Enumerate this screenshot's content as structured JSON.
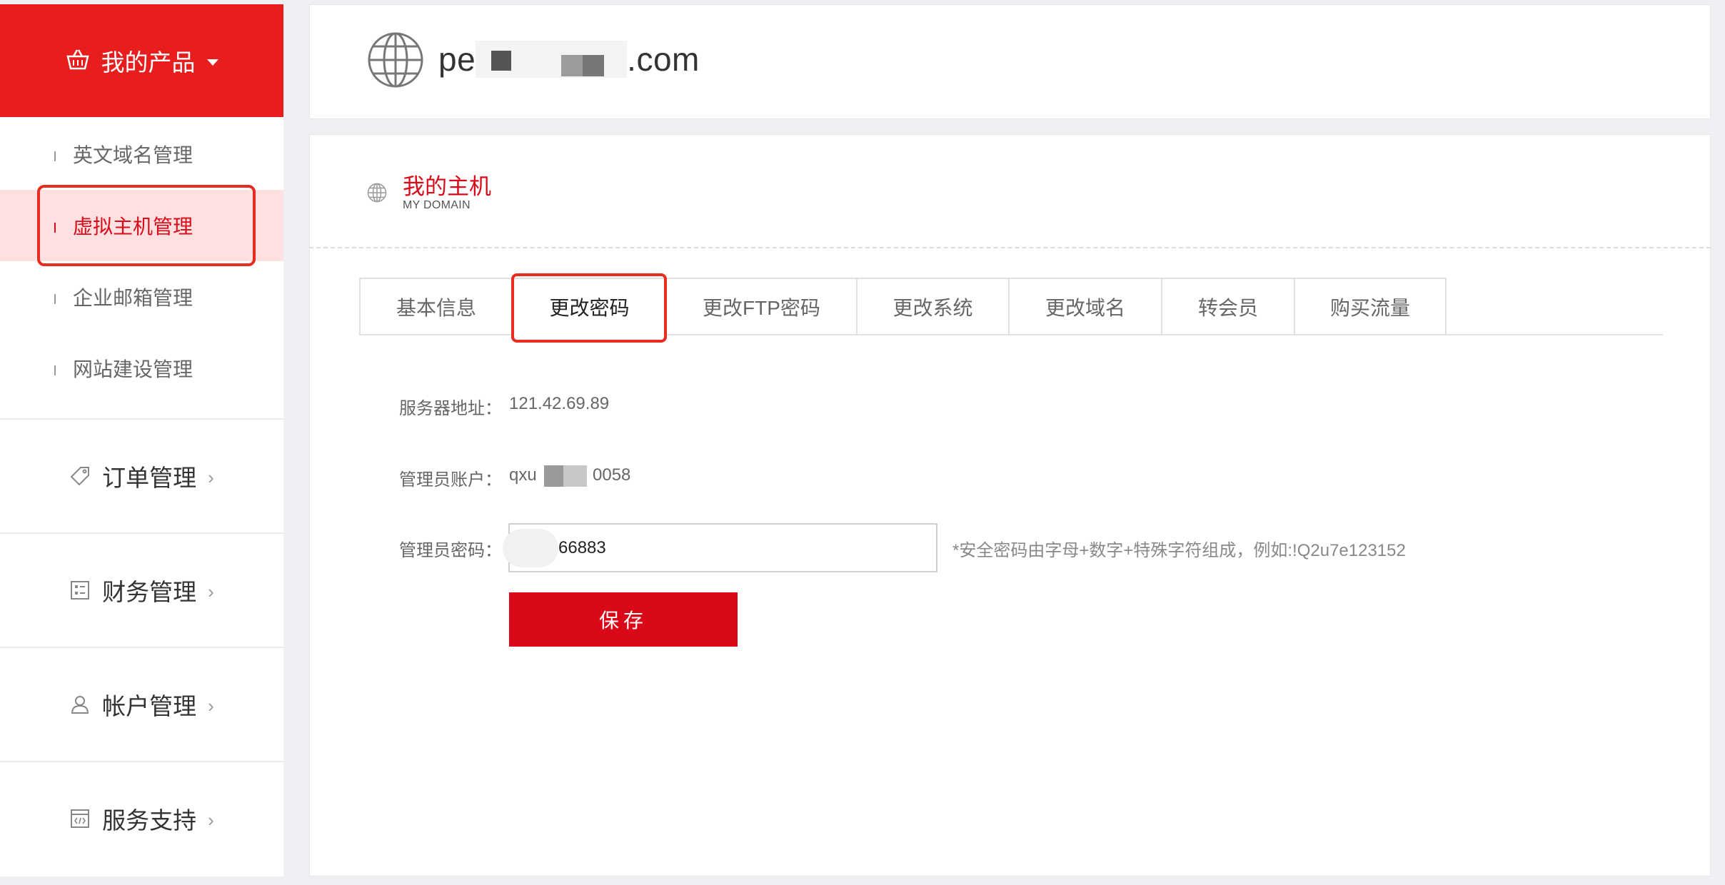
{
  "sidebar": {
    "header_label": "我的产品",
    "sub_items": [
      {
        "label": "英文域名管理"
      },
      {
        "label": "虚拟主机管理"
      },
      {
        "label": "企业邮箱管理"
      },
      {
        "label": "网站建设管理"
      }
    ],
    "groups": [
      {
        "label": "订单管理",
        "icon": "tag-icon"
      },
      {
        "label": "财务管理",
        "icon": "finance-icon"
      },
      {
        "label": "帐户管理",
        "icon": "user-icon"
      },
      {
        "label": "服务支持",
        "icon": "code-window-icon"
      }
    ],
    "chevron": "›"
  },
  "header": {
    "domain_prefix": "pe",
    "domain_suffix": ".com"
  },
  "section": {
    "title": "我的主机",
    "subtitle": "MY DOMAIN"
  },
  "tabs": [
    {
      "label": "基本信息"
    },
    {
      "label": "更改密码"
    },
    {
      "label": "更改FTP密码"
    },
    {
      "label": "更改系统"
    },
    {
      "label": "更改域名"
    },
    {
      "label": "转会员"
    },
    {
      "label": "购买流量"
    }
  ],
  "form": {
    "server_label": "服务器地址：",
    "server_value": "121.42.69.89",
    "account_label": "管理员账户：",
    "account_prefix": "qxu",
    "account_suffix": "0058",
    "password_label": "管理员密码：",
    "password_value": "66883",
    "password_hint": "*安全密码由字母+数字+特殊字符组成，例如:!Q2u7e123152",
    "save_label": "保存"
  },
  "colors": {
    "brand_red": "#e81e1e",
    "accent_red": "#d9091a",
    "highlight_box": "#e82c1f"
  }
}
